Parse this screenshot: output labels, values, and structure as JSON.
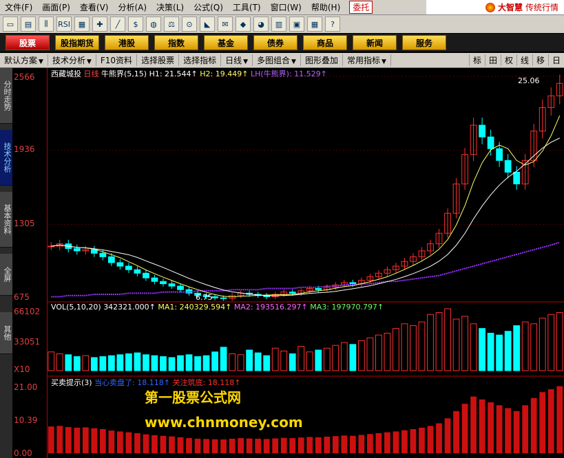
{
  "menu": {
    "items": [
      "文件(F)",
      "画面(P)",
      "查看(V)",
      "分析(A)",
      "决策(L)",
      "公式(Q)",
      "工具(T)",
      "窗口(W)",
      "帮助(H)"
    ],
    "entrust": "委托",
    "brand": "大智慧",
    "brand_sub": "传统行情"
  },
  "toolbar": {
    "rsi_label": "RSI"
  },
  "nav": {
    "buttons": [
      "股票",
      "股指期货",
      "港股",
      "指数",
      "基金",
      "债券",
      "商品",
      "新闻",
      "服务"
    ],
    "active": "股票"
  },
  "subbar": {
    "items": [
      "默认方案",
      "技术分析",
      "F10资料",
      "选择股票",
      "选择指标",
      "日线",
      "多图组合",
      "图形叠加",
      "常用指标"
    ],
    "right": [
      "标",
      "田",
      "权",
      "线",
      "移",
      "日"
    ]
  },
  "sidebar": {
    "tabs": [
      "分时走势",
      "技术分析",
      "基本资料",
      "全屏",
      "其他"
    ],
    "active": "技术分析"
  },
  "price_panel": {
    "stock": "西藏城投",
    "period": "日线",
    "indicator": "牛熊界(5,15)",
    "h1": "H1: 21.544↑",
    "h2": "H2: 19.449↑",
    "lh": "LH(牛熊界): 11.529↑",
    "y_ticks": [
      "2566",
      "1936",
      "1305",
      "675"
    ],
    "high_label": "25.06",
    "low_label": "6.75"
  },
  "vol_panel": {
    "label": "VOL(5,10,20)",
    "value": "342321.000↑",
    "ma1": "MA1: 240329.594↑",
    "ma2": "MA2: 193516.297↑",
    "ma3": "MA3: 197970.797↑",
    "y_ticks": [
      "66102",
      "33051",
      "X10"
    ]
  },
  "bs_panel": {
    "label": "买卖提示(3)",
    "l1": "当心卖盘了: 18.118↑",
    "l2": "关注筑底: 18.118↑",
    "y_ticks": [
      "21.00",
      "10.39",
      "0.00"
    ]
  },
  "watermark": {
    "line1": "第一股票公式网",
    "line2": "www.chnmoney.com"
  },
  "colors": {
    "up": "#ff3030",
    "down": "#00ffff",
    "ma_yellow": "#ffff66",
    "ma_purple": "#9933ff"
  },
  "chart_data": {
    "type": "line",
    "title": "西藏城投",
    "series": [
      {
        "name": "close",
        "values": [
          11.2,
          11.4,
          11.0,
          10.8,
          10.9,
          10.6,
          10.3,
          9.8,
          9.5,
          9.2,
          8.9,
          8.5,
          8.2,
          8.0,
          7.8,
          7.5,
          7.2,
          7.0,
          6.9,
          6.8,
          6.75,
          7.0,
          7.2,
          7.1,
          7.0,
          6.9,
          7.1,
          7.3,
          7.2,
          7.4,
          7.6,
          7.5,
          7.7,
          7.9,
          8.1,
          8.0,
          8.3,
          8.6,
          8.9,
          9.2,
          9.5,
          9.9,
          10.3,
          10.8,
          11.4,
          12.3,
          14.0,
          16.5,
          19.0,
          21.5,
          20.5,
          19.5,
          18.5,
          17.5,
          16.5,
          18.5,
          21.0,
          23.0,
          24.0,
          25.06
        ]
      },
      {
        "name": "LH(牛熊界)",
        "values": [
          6.9,
          6.9,
          7.0,
          7.0,
          7.0,
          7.1,
          7.1,
          7.1,
          7.1,
          7.2,
          7.2,
          7.2,
          7.2,
          7.3,
          7.3,
          7.3,
          7.3,
          7.4,
          7.4,
          7.4,
          7.4,
          7.5,
          7.5,
          7.5,
          7.5,
          7.6,
          7.6,
          7.6,
          7.6,
          7.7,
          7.7,
          7.7,
          7.8,
          7.8,
          7.9,
          7.9,
          8.0,
          8.0,
          8.1,
          8.2,
          8.2,
          8.3,
          8.4,
          8.5,
          8.6,
          8.7,
          8.9,
          9.1,
          9.3,
          9.5,
          9.7,
          9.9,
          10.1,
          10.3,
          10.5,
          10.7,
          10.9,
          11.1,
          11.3,
          11.529
        ]
      }
    ],
    "volume": [
      20000,
      18000,
      17000,
      15000,
      16000,
      14000,
      15000,
      16000,
      17000,
      18000,
      19000,
      17000,
      16000,
      15000,
      14000,
      16000,
      17000,
      15000,
      16000,
      20000,
      25000,
      18000,
      17000,
      22000,
      19000,
      16000,
      24000,
      21000,
      18000,
      26000,
      20000,
      22000,
      24000,
      27000,
      30000,
      28000,
      32000,
      35000,
      38000,
      40000,
      45000,
      50000,
      48000,
      52000,
      60000,
      62000,
      66000,
      55000,
      58000,
      50000,
      45000,
      40000,
      38000,
      42000,
      48000,
      52000,
      50000,
      56000,
      60000,
      62000
    ],
    "ylim": [
      6.75,
      25.66
    ]
  }
}
